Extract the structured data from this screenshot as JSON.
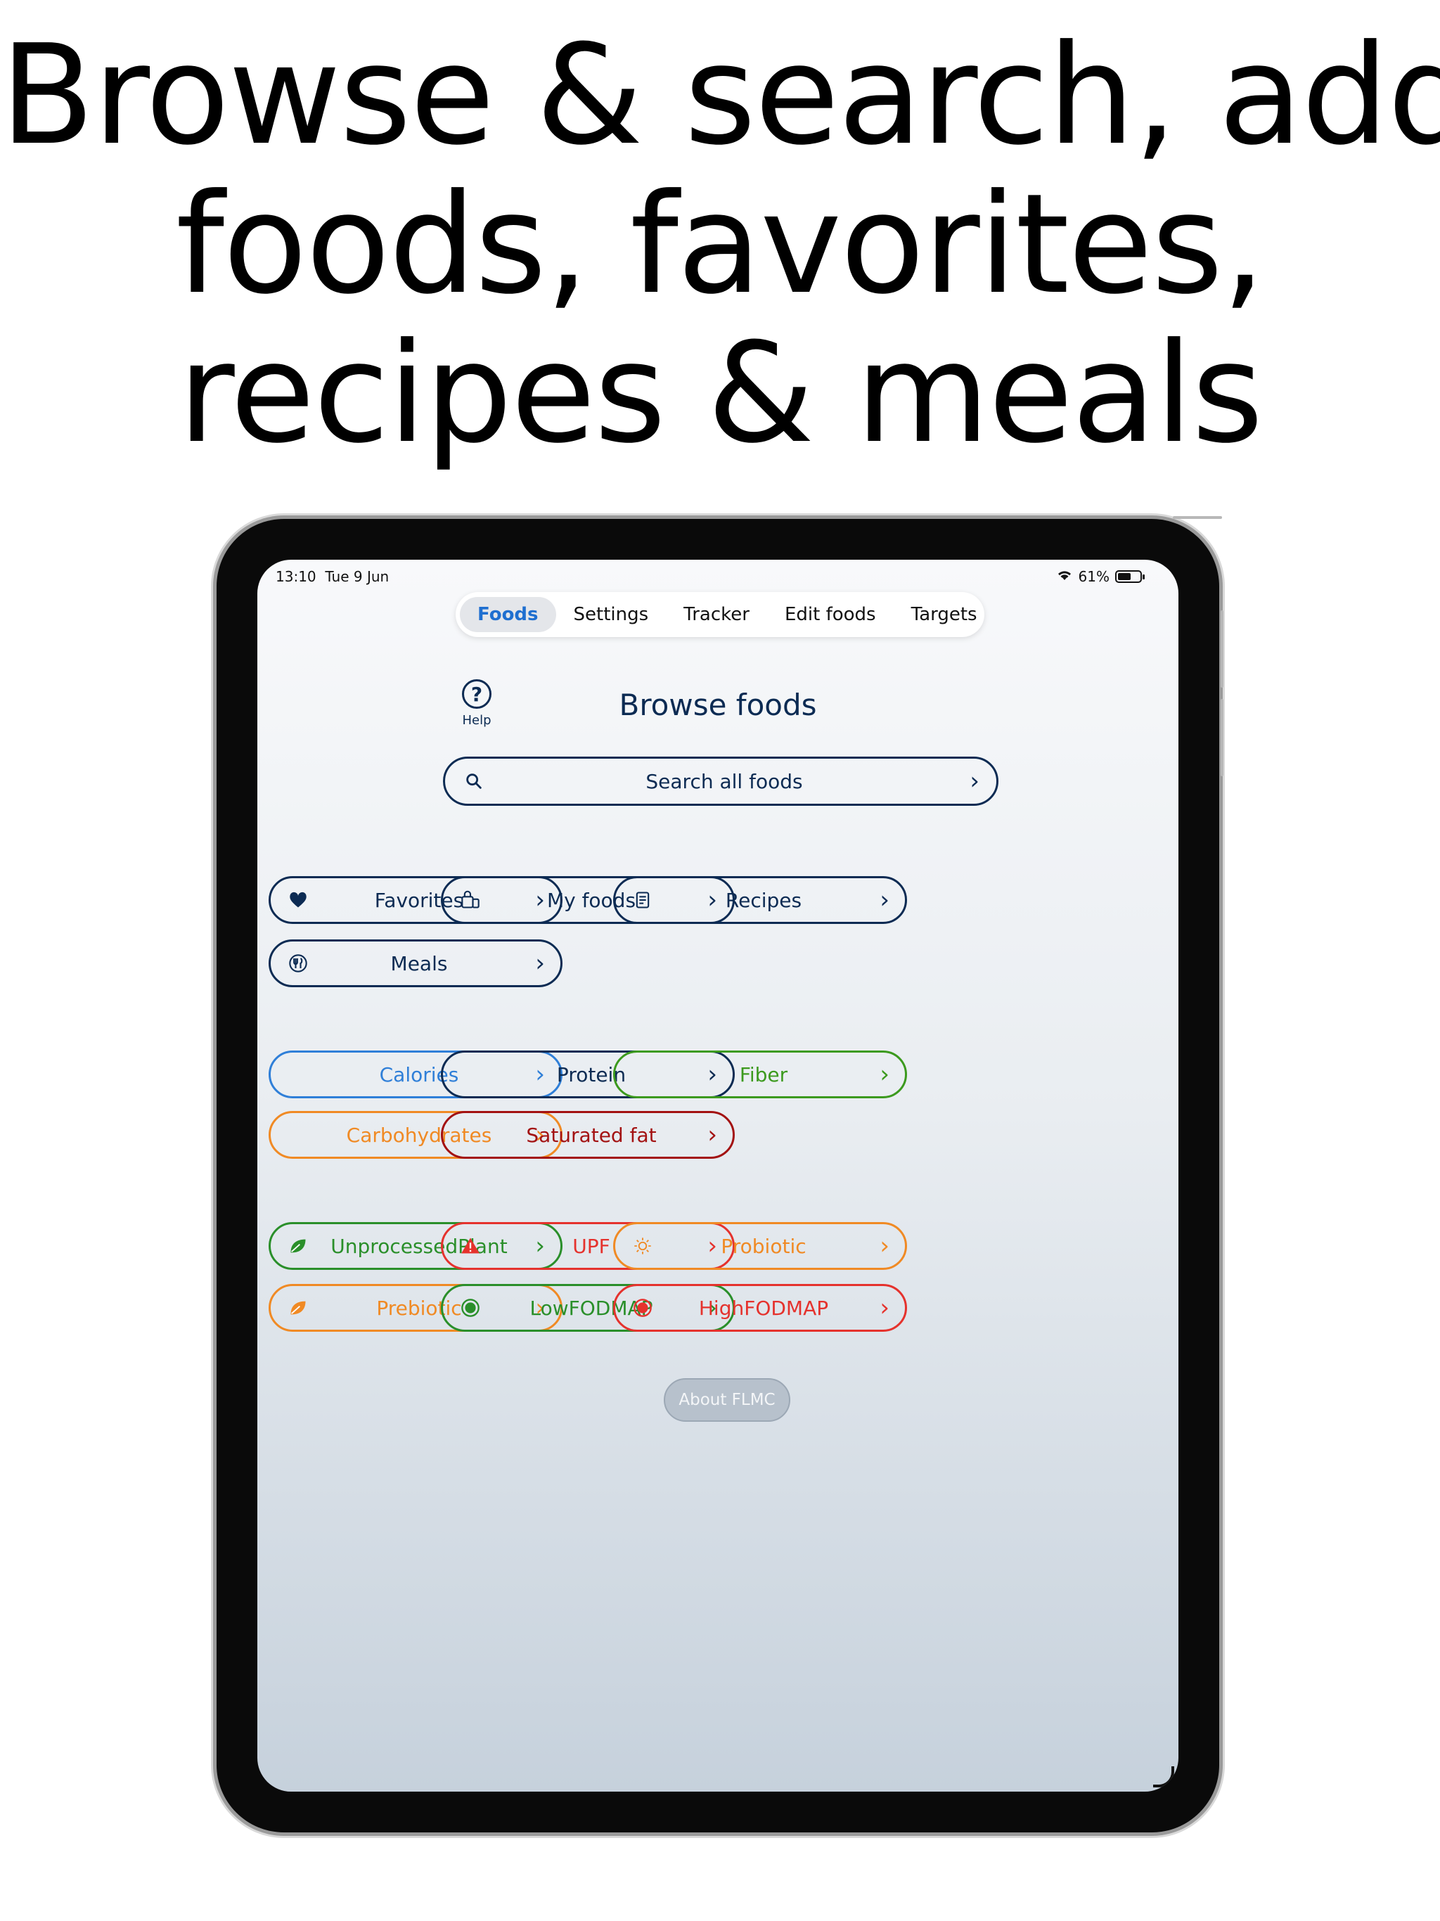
{
  "headline": [
    "Browse & search, add",
    "foods, favorites,",
    "recipes & meals"
  ],
  "status": {
    "time": "13:10",
    "date": "Tue 9 Jun",
    "battery": "61%",
    "battery_level": 0.61
  },
  "tabs": [
    {
      "label": "Foods",
      "active": true
    },
    {
      "label": "Settings",
      "active": false
    },
    {
      "label": "Tracker",
      "active": false
    },
    {
      "label": "Edit foods",
      "active": false
    },
    {
      "label": "Targets",
      "active": false
    }
  ],
  "help_label": "Help",
  "page_title": "Browse foods",
  "search_label": "Search all foods",
  "collections": [
    {
      "label": "Favorites",
      "icon": "heart-icon"
    },
    {
      "label": "My foods",
      "icon": "shopping-bag-icon"
    },
    {
      "label": "Recipes",
      "icon": "recipe-book-icon"
    },
    {
      "label": "Meals",
      "icon": "fork-knife-icon"
    }
  ],
  "nutrients": [
    {
      "label": "Calories",
      "color": "#2f7fd8"
    },
    {
      "label": "Protein",
      "color": "#0c2b53"
    },
    {
      "label": "Fiber",
      "color": "#3c9a1e"
    },
    {
      "label": "Carbohydrates",
      "color": "#f08a24"
    },
    {
      "label": "Saturated fat",
      "color": "#a31212"
    }
  ],
  "categories": [
    {
      "label": "UnprocessedPlant",
      "color": "#2a8f2a",
      "icon": "leaf-icon"
    },
    {
      "label": "UPF",
      "color": "#e5322d",
      "icon": "warning-icon"
    },
    {
      "label": "Probiotic",
      "color": "#f08a24",
      "icon": "sun-icon"
    },
    {
      "label": "Prebiotic",
      "color": "#f08a24",
      "icon": "leaf-icon"
    },
    {
      "label": "LowFODMAP",
      "color": "#2a8f2a",
      "icon": "dot-circle-icon"
    },
    {
      "label": "HighFODMAP",
      "color": "#e5322d",
      "icon": "dot-circle-icon"
    }
  ],
  "about_label": "About FLMC"
}
